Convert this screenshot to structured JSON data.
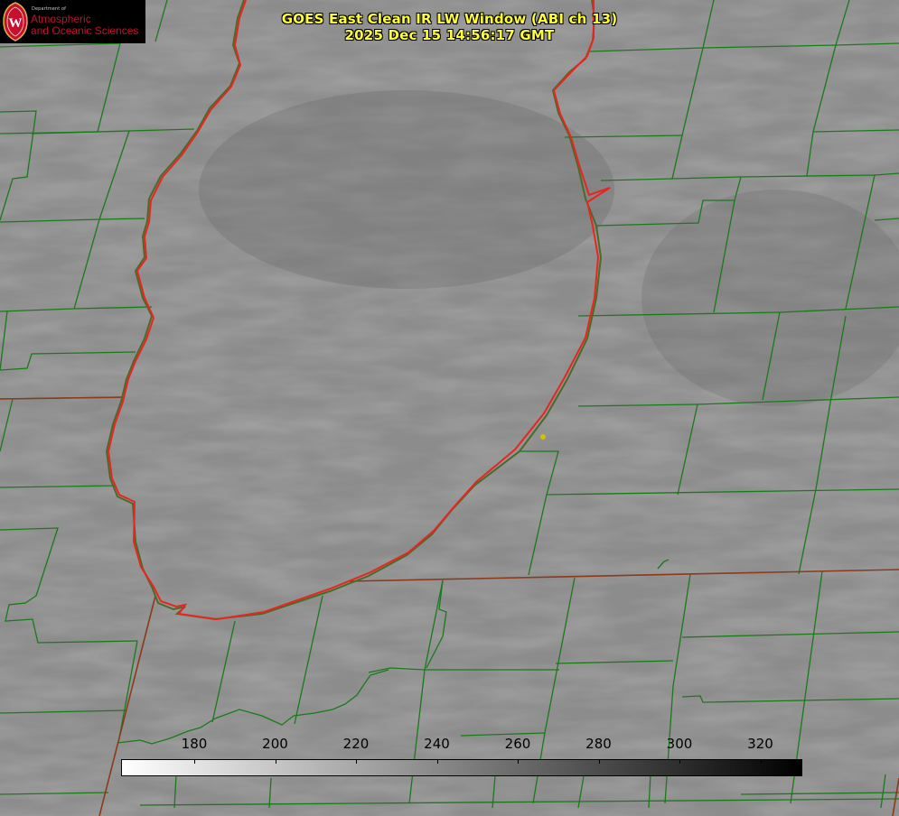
{
  "logo": {
    "department": "Department of",
    "line1": "Atmospheric",
    "line2": "and Oceanic Sciences",
    "seal_letter": "W"
  },
  "title": {
    "line1": "GOES East Clean IR LW Window (ABI ch 13)",
    "line2": "2025 Dec 15 14:56:17 GMT"
  },
  "colors": {
    "title": "#ffff33",
    "lake_outline": "#e8261f",
    "county_lines": "#1a7a1a",
    "state_lines": "#8b3a1a",
    "marker": "#d4c000",
    "logo_red": "#c5102f"
  },
  "colorbar": {
    "ticks": [
      "180",
      "200",
      "220",
      "240",
      "260",
      "280",
      "300",
      "320"
    ],
    "from_color": "#ffffff",
    "to_color": "#000000"
  }
}
